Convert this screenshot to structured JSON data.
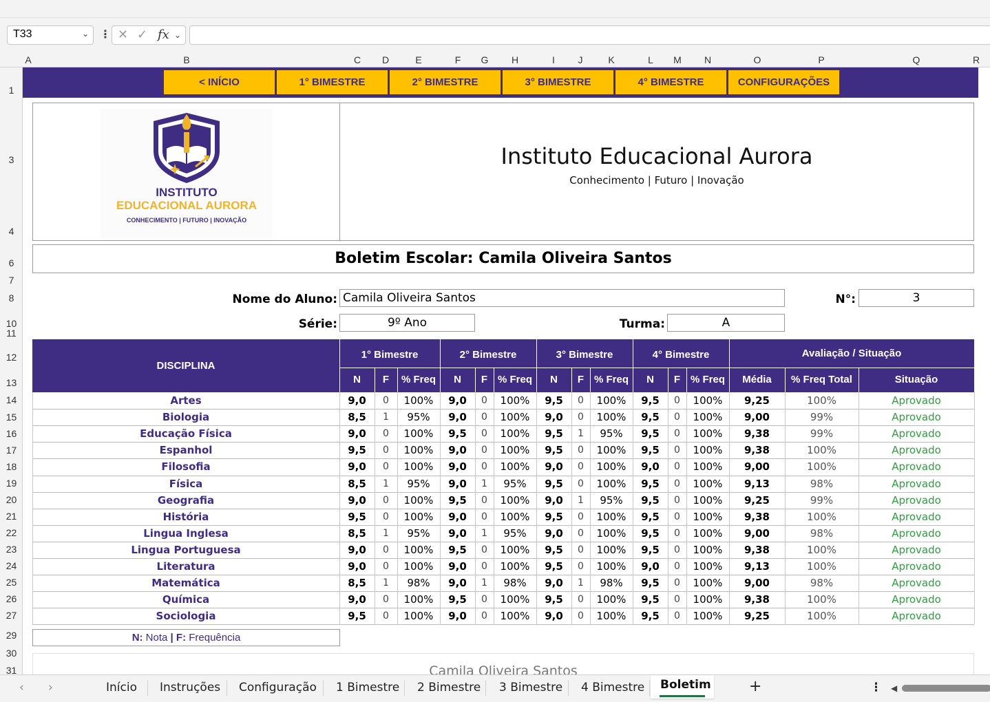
{
  "formula_bar": {
    "cell_ref": "T33",
    "fx_label": "fx",
    "formula": ""
  },
  "columns": [
    "A",
    "B",
    "C",
    "D",
    "E",
    "F",
    "G",
    "H",
    "I",
    "J",
    "K",
    "L",
    "M",
    "N",
    "O",
    "P",
    "Q",
    "R"
  ],
  "rows": [
    "1",
    "3",
    "4",
    "6",
    "7",
    "8",
    "10",
    "11",
    "12",
    "13",
    "14",
    "15",
    "16",
    "17",
    "18",
    "19",
    "20",
    "21",
    "22",
    "23",
    "24",
    "25",
    "26",
    "27",
    "29",
    "30",
    "31"
  ],
  "nav": [
    "< INÍCIO",
    "1° BIMESTRE",
    "2° BIMESTRE",
    "3° BIMESTRE",
    "4° BIMESTRE",
    "CONFIGURAÇÕES"
  ],
  "logo": {
    "line1": "INSTITUTO",
    "line2": "EDUCACIONAL AURORA",
    "line3": "CONHECIMENTO | FUTURO | INOVAÇÃO"
  },
  "school": {
    "name": "Instituto Educacional Aurora",
    "tagline": "Conhecimento | Futuro | Inovação"
  },
  "report_title": "Boletim Escolar: Camila Oliveira Santos",
  "student": {
    "name_label": "Nome do Aluno:",
    "name": "Camila Oliveira Santos",
    "number_label": "N°:",
    "number": "3",
    "grade_label": "Série:",
    "grade": "9º Ano",
    "class_label": "Turma:",
    "class": "A"
  },
  "table": {
    "discipline_header": "DISCIPLINA",
    "bimesters": [
      "1° Bimestre",
      "2° Bimestre",
      "3° Bimestre",
      "4° Bimestre"
    ],
    "evaluation_header": "Avaliação / Situação",
    "sub_headers": [
      "N",
      "F",
      "% Freq"
    ],
    "eval_sub_headers": [
      "Média",
      "% Freq Total",
      "Situação"
    ],
    "rows": [
      [
        "Artes",
        "9,0",
        "0",
        "100%",
        "9,0",
        "0",
        "100%",
        "9,5",
        "0",
        "100%",
        "9,5",
        "0",
        "100%",
        "9,25",
        "100%",
        "Aprovado"
      ],
      [
        "Biologia",
        "8,5",
        "1",
        "95%",
        "9,0",
        "0",
        "100%",
        "9,0",
        "0",
        "100%",
        "9,5",
        "0",
        "100%",
        "9,00",
        "99%",
        "Aprovado"
      ],
      [
        "Educação Física",
        "9,0",
        "0",
        "100%",
        "9,5",
        "0",
        "100%",
        "9,5",
        "1",
        "95%",
        "9,5",
        "0",
        "100%",
        "9,38",
        "99%",
        "Aprovado"
      ],
      [
        "Espanhol",
        "9,5",
        "0",
        "100%",
        "9,0",
        "0",
        "100%",
        "9,5",
        "0",
        "100%",
        "9,5",
        "0",
        "100%",
        "9,38",
        "100%",
        "Aprovado"
      ],
      [
        "Filosofia",
        "9,0",
        "0",
        "100%",
        "9,0",
        "0",
        "100%",
        "9,0",
        "0",
        "100%",
        "9,0",
        "0",
        "100%",
        "9,00",
        "100%",
        "Aprovado"
      ],
      [
        "Física",
        "8,5",
        "1",
        "95%",
        "9,0",
        "1",
        "95%",
        "9,5",
        "0",
        "100%",
        "9,5",
        "0",
        "100%",
        "9,13",
        "98%",
        "Aprovado"
      ],
      [
        "Geografia",
        "9,0",
        "0",
        "100%",
        "9,5",
        "0",
        "100%",
        "9,0",
        "1",
        "95%",
        "9,5",
        "0",
        "100%",
        "9,25",
        "99%",
        "Aprovado"
      ],
      [
        "História",
        "9,5",
        "0",
        "100%",
        "9,0",
        "0",
        "100%",
        "9,5",
        "0",
        "100%",
        "9,5",
        "0",
        "100%",
        "9,38",
        "100%",
        "Aprovado"
      ],
      [
        "Lingua Inglesa",
        "8,5",
        "1",
        "95%",
        "9,0",
        "1",
        "95%",
        "9,0",
        "0",
        "100%",
        "9,5",
        "0",
        "100%",
        "9,00",
        "98%",
        "Aprovado"
      ],
      [
        "Lingua Portuguesa",
        "9,0",
        "0",
        "100%",
        "9,5",
        "0",
        "100%",
        "9,5",
        "0",
        "100%",
        "9,5",
        "0",
        "100%",
        "9,38",
        "100%",
        "Aprovado"
      ],
      [
        "Literatura",
        "9,0",
        "0",
        "100%",
        "9,0",
        "0",
        "100%",
        "9,5",
        "0",
        "100%",
        "9,0",
        "0",
        "100%",
        "9,13",
        "100%",
        "Aprovado"
      ],
      [
        "Matemática",
        "8,5",
        "1",
        "98%",
        "9,0",
        "1",
        "98%",
        "9,0",
        "1",
        "98%",
        "9,5",
        "0",
        "100%",
        "9,00",
        "98%",
        "Aprovado"
      ],
      [
        "Química",
        "9,0",
        "0",
        "100%",
        "9,5",
        "0",
        "100%",
        "9,5",
        "0",
        "100%",
        "9,5",
        "0",
        "100%",
        "9,38",
        "100%",
        "Aprovado"
      ],
      [
        "Sociologia",
        "9,5",
        "0",
        "100%",
        "9,0",
        "0",
        "100%",
        "9,0",
        "0",
        "100%",
        "9,5",
        "0",
        "100%",
        "9,25",
        "100%",
        "Aprovado"
      ]
    ]
  },
  "legend": {
    "n_key": "N:",
    "n_text": " Nota ",
    "sep": "|",
    "f_key": " F:",
    "f_text": " Frequência"
  },
  "lower_name": "Camila Oliveira Santos",
  "tabs": [
    "Início",
    "Instruções",
    "Configuração",
    "1 Bimestre",
    "2 Bimestre",
    "3 Bimestre",
    "4 Bimestre",
    "Boletim"
  ],
  "colors": {
    "brand": "#3f2d83",
    "accent": "#ffc000",
    "approved": "#2e9e3e"
  }
}
